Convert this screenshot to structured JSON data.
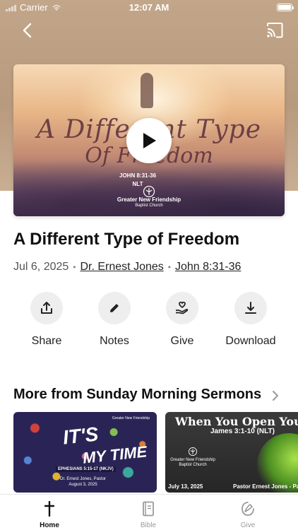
{
  "status_bar": {
    "carrier": "Carrier",
    "time": "12:07 AM"
  },
  "nav": {
    "back_icon": "chevron-left-icon",
    "cast_icon": "cast-icon"
  },
  "artwork": {
    "title_line1": "A Different Type",
    "title_line2": "Of Freedom",
    "scripture_line1": "JOHN 8:31-36",
    "scripture_line2": "NLT",
    "church_line1": "Greater New Friendship",
    "church_line2": "Baptist Church",
    "play_icon": "play-icon"
  },
  "sermon": {
    "title": "A Different Type of Freedom",
    "date": "Jul 6, 2025",
    "speaker": "Dr. Ernest Jones",
    "passage": "John 8:31-36"
  },
  "actions": [
    {
      "label": "Share",
      "icon": "share-icon"
    },
    {
      "label": "Notes",
      "icon": "pencil-icon"
    },
    {
      "label": "Give",
      "icon": "give-hand-heart-icon"
    },
    {
      "label": "Download",
      "icon": "download-icon"
    }
  ],
  "more_section": {
    "title": "More from Sunday Morning Sermons",
    "cards": [
      {
        "headline_1": "IT'S",
        "headline_2": "MY TIME",
        "reference": "EPHESIANS 5:15-17 (NKJV)",
        "pastor": "Dr. Ernest Jones, Pastor",
        "date": "August 3, 2025",
        "church": "Greater New Friendship"
      },
      {
        "headline": "When You Open Your Mouth",
        "verse": "James 3:1-10 (NLT)",
        "church_line1": "Greater New Friendship",
        "church_line2": "Baptist Church",
        "date": "July 13, 2025",
        "pastor": "Pastor Ernest Jones - Pastor"
      }
    ]
  },
  "tabbar": [
    {
      "label": "Home",
      "icon": "cross-icon",
      "active": true
    },
    {
      "label": "Bible",
      "icon": "bible-icon",
      "active": false
    },
    {
      "label": "Give",
      "icon": "give-icon",
      "active": false
    }
  ],
  "colors": {
    "accent": "#111111",
    "inactive_tab": "#9a9a9a",
    "action_circle": "#eeeeee",
    "hero_bg": "#c2a68a"
  }
}
